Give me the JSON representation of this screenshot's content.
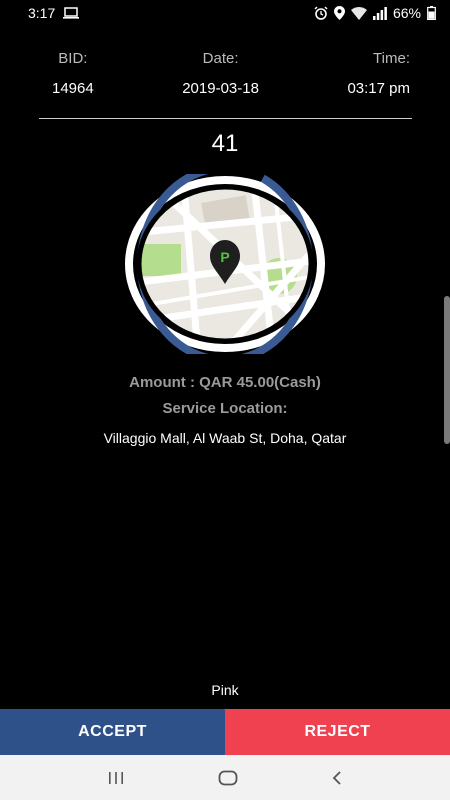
{
  "status_bar": {
    "time": "3:17",
    "battery": "66%",
    "icons": [
      "laptop-icon",
      "alarm-icon",
      "location-icon",
      "wifi-icon",
      "signal-icon",
      "battery-icon"
    ]
  },
  "booking": {
    "bid_label": "BID:",
    "bid_value": "14964",
    "date_label": "Date:",
    "date_value": "2019-03-18",
    "time_label": "Time:",
    "time_value": "03:17 pm"
  },
  "countdown": {
    "value": "41",
    "remaining_fraction": 0.93
  },
  "details": {
    "amount": "Amount : QAR 45.00(Cash)",
    "service_location_label": "Service Location:",
    "address": "Villaggio Mall, Al Waab St, Doha, Qatar"
  },
  "car_color": "Pink",
  "actions": {
    "accept_label": "ACCEPT",
    "reject_label": "REJECT"
  },
  "colors": {
    "accept": "#2f5189",
    "reject": "#ef4150",
    "ring": "#3a5a93",
    "pin_letter": "#55c23c"
  },
  "nav": [
    "recent-apps-icon",
    "home-icon",
    "back-icon"
  ]
}
